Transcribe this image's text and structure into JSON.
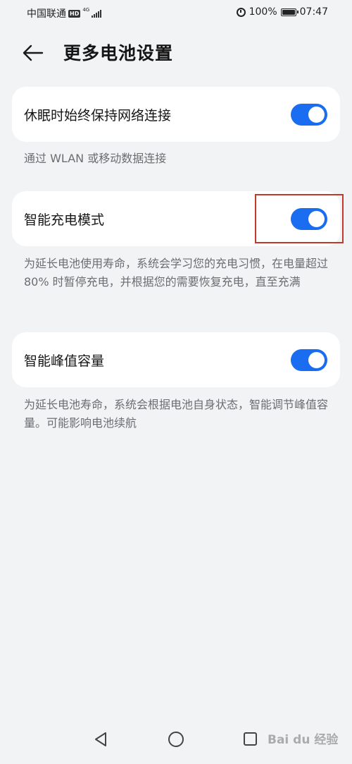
{
  "status_bar": {
    "carrier": "中国联通",
    "hd_badge": "HD",
    "network_type": "4G",
    "battery_percent": "100%",
    "time": "07:47"
  },
  "header": {
    "title": "更多电池设置"
  },
  "settings": [
    {
      "label": "休眠时始终保持网络连接",
      "enabled": true,
      "description": "通过 WLAN 或移动数据连接"
    },
    {
      "label": "智能充电模式",
      "enabled": true,
      "description": "为延长电池使用寿命，系统会学习您的充电习惯，在电量超过 80% 时暂停充电，并根据您的需要恢复充电，直至充满"
    },
    {
      "label": "智能峰值容量",
      "enabled": true,
      "description": "为延长电池寿命，系统会根据电池自身状态，智能调节峰值容量。可能影响电池续航"
    }
  ],
  "colors": {
    "background": "#f1f3f5",
    "card": "#ffffff",
    "toggle_on": "#1a6cf0",
    "highlight": "#c0392b"
  },
  "icons": {
    "back": "arrow-left",
    "nav_back": "triangle-left",
    "nav_home": "circle",
    "nav_recent": "square"
  },
  "watermark": "Bai du 经验"
}
